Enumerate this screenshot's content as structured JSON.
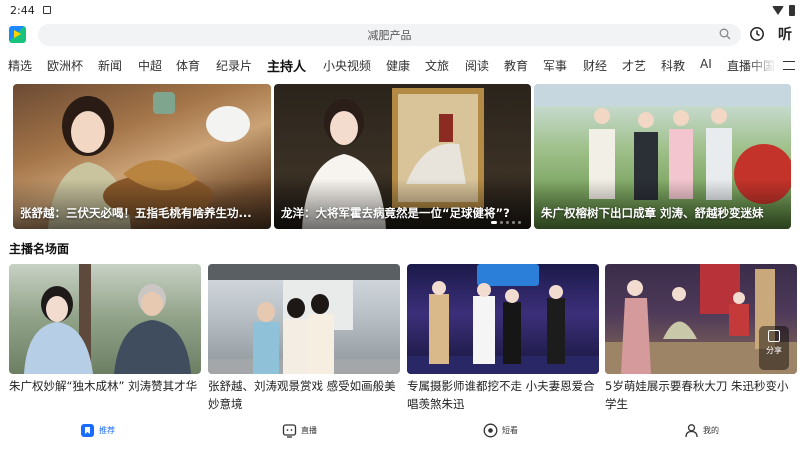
{
  "status_bar": {
    "time": "2:44"
  },
  "search": {
    "placeholder": "减肥产品"
  },
  "header": {
    "listen_label": "听"
  },
  "tabs": [
    {
      "label": "精选"
    },
    {
      "label": "欧洲杯"
    },
    {
      "label": "新闻"
    },
    {
      "label": "中超"
    },
    {
      "label": "体育"
    },
    {
      "label": "纪录片"
    },
    {
      "label": "主持人",
      "active": true
    },
    {
      "label": "小央视频"
    },
    {
      "label": "健康"
    },
    {
      "label": "文旅"
    },
    {
      "label": "阅读"
    },
    {
      "label": "教育"
    },
    {
      "label": "军事"
    },
    {
      "label": "财经"
    },
    {
      "label": "才艺"
    },
    {
      "label": "科教"
    },
    {
      "label": "AI"
    },
    {
      "label": "直播中国"
    }
  ],
  "carousel": [
    {
      "title": "张舒越：三伏天必喝！五指毛桃有啥养生功..."
    },
    {
      "title": "龙洋：大将军霍去病竟然是一位“足球健将”?"
    },
    {
      "title": "朱广权榕树下出口成章 刘涛、舒越秒变迷妹"
    }
  ],
  "section": {
    "title": "主播名场面"
  },
  "grid": [
    {
      "title": "朱广权妙解“独木成林” 刘涛赞其才华"
    },
    {
      "title": "张舒越、刘涛观景赏戏 感受如画般美妙意境"
    },
    {
      "title": "专属摄影师谁都挖不走 小夫妻恩爱合唱羡煞朱迅"
    },
    {
      "title": "5岁萌娃展示要春秋大刀 朱迅秒变小学生"
    }
  ],
  "share": {
    "label": "分享"
  },
  "bottom_nav": [
    {
      "label": "推荐",
      "active": true
    },
    {
      "label": "直播"
    },
    {
      "label": "短看"
    },
    {
      "label": "我的"
    }
  ],
  "colors": {
    "accent": "#1a6cff",
    "text": "#222222",
    "search_bg": "#f2f3f5"
  }
}
